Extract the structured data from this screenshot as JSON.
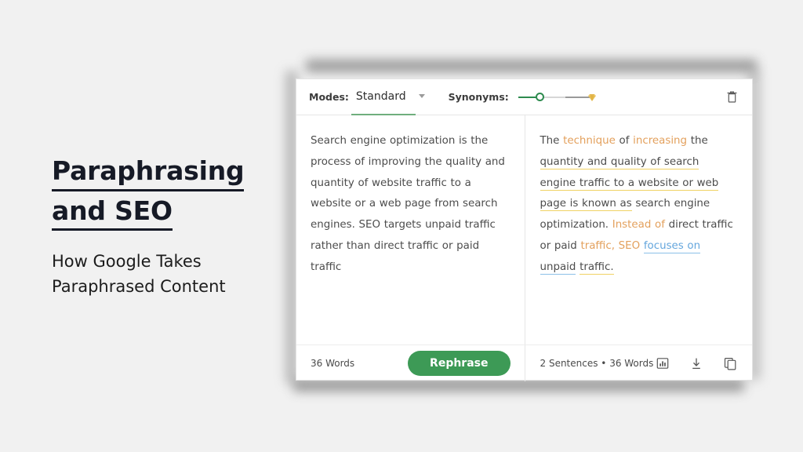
{
  "slide": {
    "title_line1": "Paraphrasing",
    "title_line2": "and SEO",
    "subtitle_line1": "How Google Takes",
    "subtitle_line2": "Paraphrased Content",
    "background_color": "#f1f1f1",
    "title_color": "#161a26"
  },
  "card": {
    "toolbar": {
      "modes_label": "Modes:",
      "modes_value": "Standard",
      "modes_chevron_icon": "chevron-down-icon",
      "modes_underline_color": "#6fae7d",
      "synonyms_label": "Synonyms:",
      "slider_fill_color": "#2e8b4f",
      "slider_track_color": "#d7d7d7",
      "premium_icon": "gem-icon",
      "premium_icon_color": "#e8c15a",
      "delete_icon": "trash-icon"
    },
    "input_pane": {
      "text": "Search engine optimization is the process of improving the quality and quantity of website traffic to a website or a web page from search engines. SEO targets unpaid traffic rather than direct traffic or paid traffic",
      "word_count": "36 Words",
      "rephrase_label": "Rephrase",
      "rephrase_color": "#3d9a56"
    },
    "output_pane": {
      "text": "The technique of increasing the quantity and quality of search engine traffic to a website or web page is known as search engine optimization. Instead of direct traffic or paid traffic, SEO focuses on unpaid traffic.",
      "stats": "2 Sentences • 36 Words",
      "highlight_orange": "#e3a05c",
      "highlight_blue": "#64a6dd",
      "underline_yellow": "#f0d264",
      "underline_blue": "#8cc0e8",
      "actions": [
        {
          "name": "statistics-icon",
          "label": "Statistics"
        },
        {
          "name": "download-icon",
          "label": "Download"
        },
        {
          "name": "copy-icon",
          "label": "Copy"
        }
      ]
    }
  }
}
